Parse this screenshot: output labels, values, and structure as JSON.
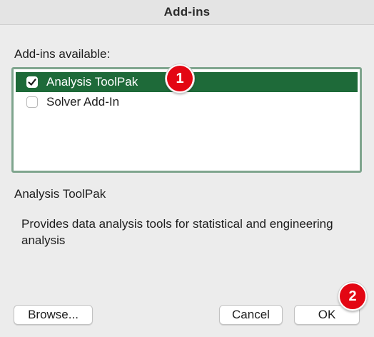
{
  "window": {
    "title": "Add-ins"
  },
  "list": {
    "label": "Add-ins available:",
    "items": [
      {
        "label": "Analysis ToolPak",
        "checked": true,
        "selected": true
      },
      {
        "label": "Solver Add-In",
        "checked": false,
        "selected": false
      }
    ]
  },
  "selection": {
    "title": "Analysis ToolPak",
    "description": "Provides data analysis tools for statistical and engineering analysis"
  },
  "buttons": {
    "browse": "Browse...",
    "cancel": "Cancel",
    "ok": "OK"
  },
  "annotations": {
    "step1": "1",
    "step2": "2"
  },
  "colors": {
    "selection_bg": "#1e6a39",
    "list_border": "#7fa58e",
    "badge": "#e30613",
    "window_bg": "#ececec"
  }
}
